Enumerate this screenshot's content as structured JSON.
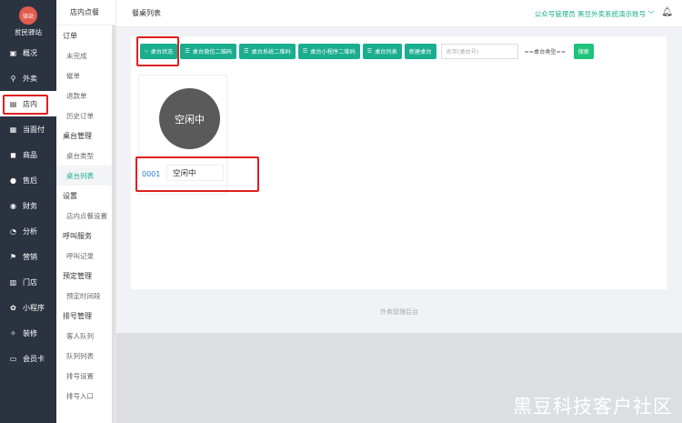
{
  "brand": {
    "name": "贫民驿站",
    "logo_text": "驿站"
  },
  "sidebar": {
    "items": [
      {
        "label": "概况",
        "icon": "overview-icon"
      },
      {
        "label": "外卖",
        "icon": "scooter-icon"
      },
      {
        "label": "店内",
        "icon": "store-icon",
        "active": true
      },
      {
        "label": "当面付",
        "icon": "pay-icon"
      },
      {
        "label": "商品",
        "icon": "goods-icon"
      },
      {
        "label": "售后",
        "icon": "aftersale-icon"
      },
      {
        "label": "财务",
        "icon": "finance-icon"
      },
      {
        "label": "分析",
        "icon": "analysis-icon"
      },
      {
        "label": "营销",
        "icon": "marketing-icon"
      },
      {
        "label": "门店",
        "icon": "shop-icon"
      },
      {
        "label": "小程序",
        "icon": "miniapp-icon"
      },
      {
        "label": "装修",
        "icon": "decorate-icon"
      },
      {
        "label": "会员卡",
        "icon": "member-card-icon"
      }
    ]
  },
  "submenu": {
    "title": "店内点餐",
    "groups": [
      {
        "label": "订单",
        "items": [
          "未完成",
          "催单",
          "退款单",
          "历史订单"
        ]
      },
      {
        "label": "桌台管理",
        "items": [
          "桌台类型",
          "桌台列表"
        ]
      },
      {
        "label": "设置",
        "items": [
          "店内点餐设置"
        ]
      },
      {
        "label": "呼叫服务",
        "items": [
          "呼叫记录"
        ]
      },
      {
        "label": "预定管理",
        "items": [
          "预定时间段"
        ]
      },
      {
        "label": "排号管理",
        "items": [
          "客人队列",
          "队列列表",
          "排号设置",
          "排号入口"
        ]
      }
    ],
    "active_item": "桌台列表"
  },
  "topbar": {
    "title": "餐桌列表",
    "account": "公众号管理员 黑豆外卖系统演示账号 ﹀"
  },
  "toolbar": {
    "buttons": [
      {
        "label": "桌台状态",
        "icon": "circle-icon"
      },
      {
        "label": "桌台微信二维码",
        "icon": "list-icon"
      },
      {
        "label": "桌台系统二维码",
        "icon": "list-icon"
      },
      {
        "label": "桌台小程序二维码",
        "icon": "list-icon"
      },
      {
        "label": "桌台列表",
        "icon": "list-icon"
      },
      {
        "label": "新建桌台",
        "icon": ""
      }
    ],
    "search_placeholder": "名字(桌台号)",
    "type_select": "==桌台类型==",
    "search_label": "搜索"
  },
  "table": {
    "number": "0001",
    "status_circle": "空闲中",
    "status_label": "空闲中"
  },
  "footer": {
    "text": "外卖管理后台"
  },
  "watermark": "黑豆科技客户社区",
  "colors": {
    "accent": "#1aad8e",
    "sidebar_bg": "#2b3340",
    "highlight": "#e02020"
  }
}
